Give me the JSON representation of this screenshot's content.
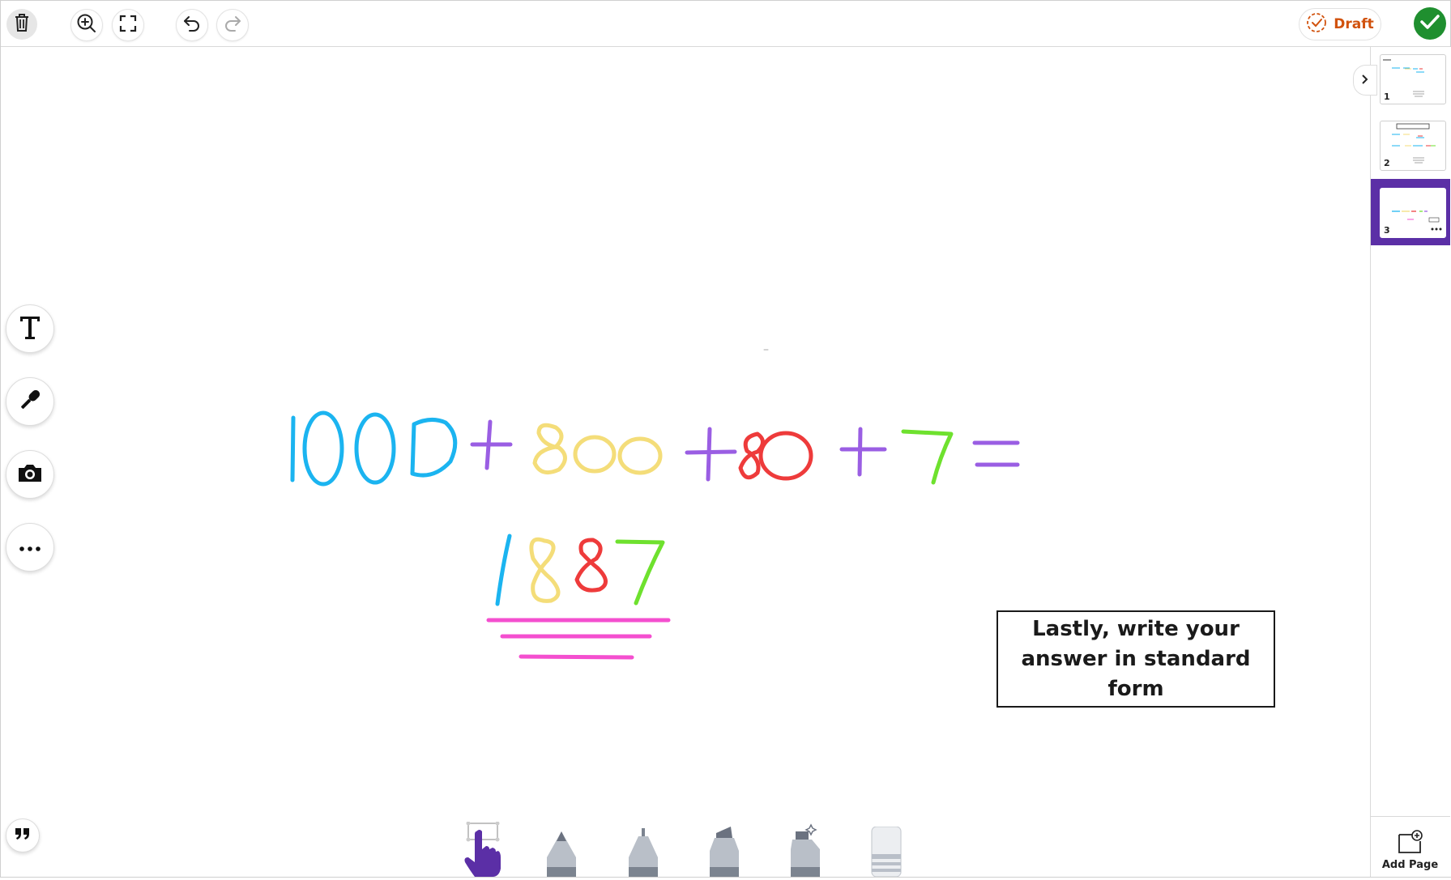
{
  "toolbar": {
    "draft_label": "Draft",
    "icons": [
      "trash-icon",
      "zoom-in-icon",
      "fullscreen-icon",
      "undo-icon",
      "redo-icon",
      "draft-check-icon",
      "done-check-icon"
    ]
  },
  "left_tools": [
    "text-tool-icon",
    "microphone-icon",
    "camera-icon",
    "more-icon",
    "quote-icon"
  ],
  "pages": {
    "thumbnails": [
      {
        "number": "1"
      },
      {
        "number": "2"
      },
      {
        "number": "3",
        "selected": true
      }
    ],
    "add_page_label": "Add Page"
  },
  "canvas": {
    "instruction": "Lastly, write your answer in standard form",
    "ink_colors": {
      "blue": "#1bb4f0",
      "purple": "#9a5ee3",
      "yellow": "#f4dd79",
      "red": "#ee3b3b",
      "green": "#6ee12e",
      "pink": "#f44fcf"
    }
  },
  "pen_tray": [
    "hand-pointer-tool",
    "pencil-tool",
    "pen-tool",
    "marker-tool",
    "highlighter-tool",
    "eraser-tool"
  ],
  "colors": {
    "accent": "#5b2fa6",
    "draft": "#d1520d",
    "done": "#1f8f2f"
  }
}
